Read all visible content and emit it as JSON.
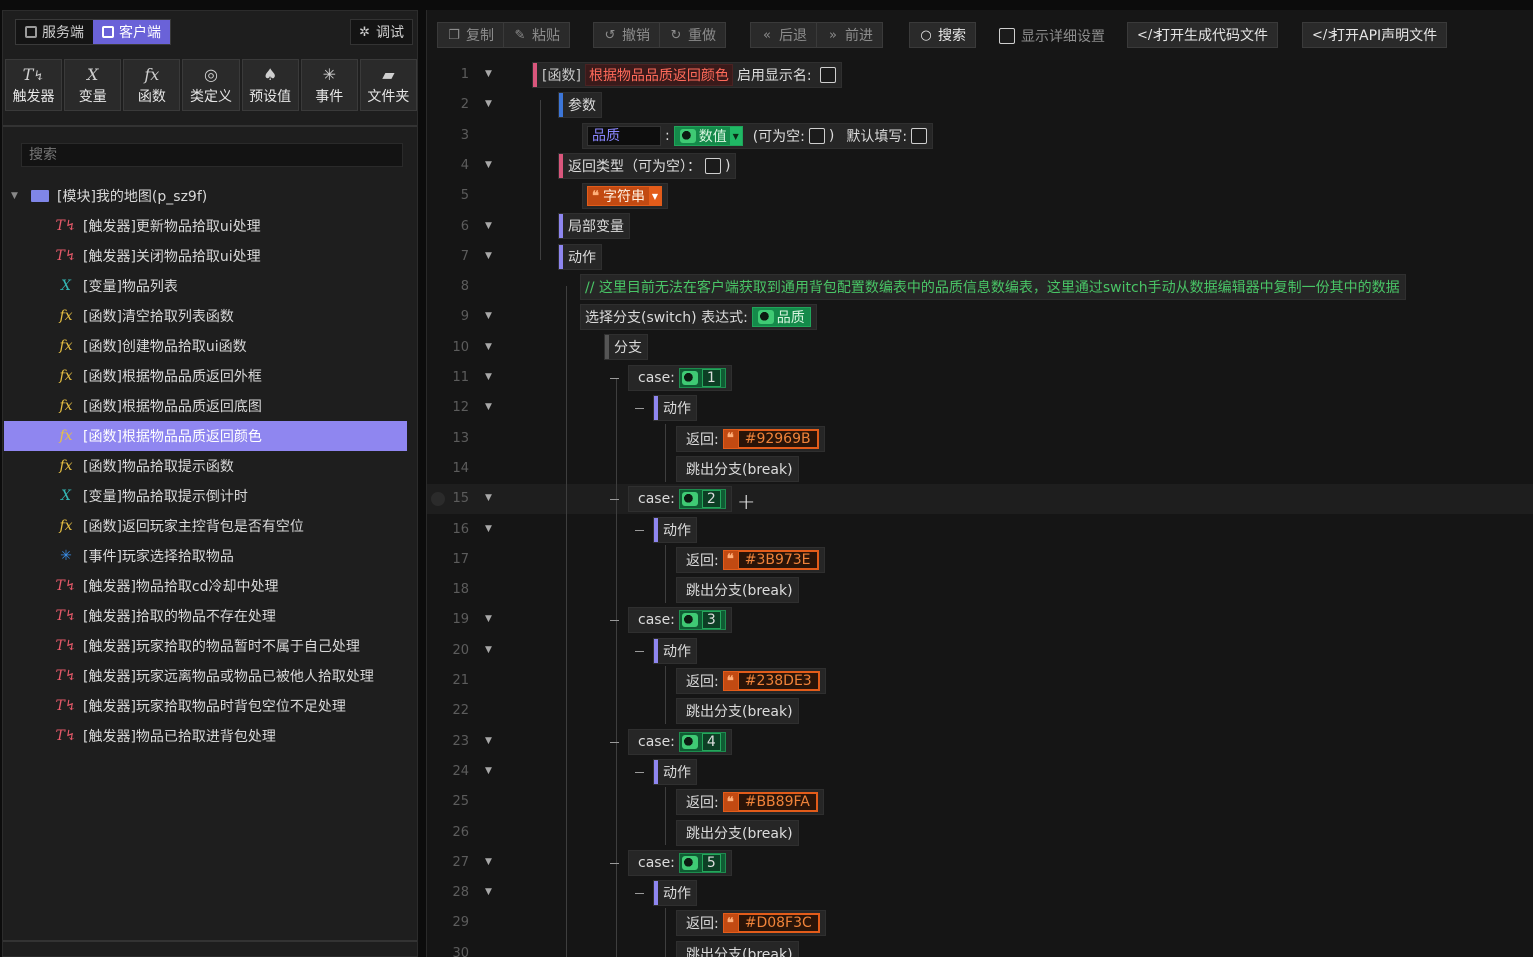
{
  "left_panel": {
    "tabs": [
      {
        "label": "服务端",
        "icon": "server-icon",
        "active": false
      },
      {
        "label": "客户端",
        "icon": "client-icon",
        "active": true
      }
    ],
    "debug_label": "调试",
    "tools": [
      {
        "label": "触发器",
        "icon": "trigger-icon"
      },
      {
        "label": "变量",
        "icon": "variable-icon"
      },
      {
        "label": "函数",
        "icon": "function-icon"
      },
      {
        "label": "类定义",
        "icon": "class-icon"
      },
      {
        "label": "预设值",
        "icon": "preset-icon"
      },
      {
        "label": "事件",
        "icon": "event-icon"
      },
      {
        "label": "文件夹",
        "icon": "folder-add-icon"
      }
    ],
    "search_placeholder": "搜索",
    "tree_root": "[模块]我的地图(p_sz9f)",
    "tree_items": [
      {
        "label": "[触发器]更新物品拾取ui处理",
        "kind": "trigger"
      },
      {
        "label": "[触发器]关闭物品拾取ui处理",
        "kind": "trigger"
      },
      {
        "label": "[变量]物品列表",
        "kind": "variable"
      },
      {
        "label": "[函数]清空拾取列表函数",
        "kind": "function"
      },
      {
        "label": "[函数]创建物品拾取ui函数",
        "kind": "function"
      },
      {
        "label": "[函数]根据物品品质返回外框",
        "kind": "function"
      },
      {
        "label": "[函数]根据物品品质返回底图",
        "kind": "function"
      },
      {
        "label": "[函数]根据物品品质返回颜色",
        "kind": "function",
        "selected": true
      },
      {
        "label": "[函数]物品拾取提示函数",
        "kind": "function"
      },
      {
        "label": "[变量]物品拾取提示倒计时",
        "kind": "variable"
      },
      {
        "label": "[函数]返回玩家主控背包是否有空位",
        "kind": "function"
      },
      {
        "label": "[事件]玩家选择拾取物品",
        "kind": "event"
      },
      {
        "label": "[触发器]物品拾取cd冷却中处理",
        "kind": "trigger"
      },
      {
        "label": "[触发器]拾取的物品不存在处理",
        "kind": "trigger"
      },
      {
        "label": "[触发器]玩家拾取的物品暂时不属于自己处理",
        "kind": "trigger"
      },
      {
        "label": "[触发器]玩家远离物品或物品已被他人拾取处理",
        "kind": "trigger"
      },
      {
        "label": "[触发器]玩家拾取物品时背包空位不足处理",
        "kind": "trigger"
      },
      {
        "label": "[触发器]物品已拾取进背包处理",
        "kind": "trigger"
      }
    ]
  },
  "toolbar": {
    "copy": "复制",
    "paste": "粘贴",
    "undo": "撤销",
    "redo": "重做",
    "back": "后退",
    "forward": "前进",
    "search": "搜索",
    "show_detail": "显示详细设置",
    "open_gen_code": "打开生成代码文件",
    "open_api_decl": "打开API声明文件"
  },
  "editor": {
    "func_tag": "[函数]",
    "func_name": "根据物品品质返回颜色",
    "enable_display_name": "启用显示名:",
    "params_label": "参数",
    "param_name": "品质",
    "param_colon": ":",
    "param_type": "数值",
    "nullable": "(可为空:",
    "nullable_close": ")",
    "default_fill": "默认填写:",
    "return_type": "返回类型（可为空）：",
    "return_type_close": ")",
    "return_type_value": "字符串",
    "local_vars": "局部变量",
    "actions": "动作",
    "comment": "// 这里目前无法在客户端获取到通用背包配置数编表中的品质信息数编表，这里通过switch手动从数据编辑器中复制一份其中的数据",
    "switch_label": "选择分支(switch) 表达式:",
    "switch_expr": "品质",
    "branch": "分支",
    "case_label": "case:",
    "return_label": "返回:",
    "break_label": "跳出分支(break)",
    "cases": [
      {
        "value": "1",
        "color": "#92969B"
      },
      {
        "value": "2",
        "color": "#3B973E"
      },
      {
        "value": "3",
        "color": "#238DE3"
      },
      {
        "value": "4",
        "color": "#BB89FA"
      },
      {
        "value": "5",
        "color": "#D08F3C"
      }
    ],
    "line_numbers": [
      "1",
      "2",
      "3",
      "4",
      "5",
      "6",
      "7",
      "8",
      "9",
      "10",
      "11",
      "12",
      "13",
      "14",
      "15",
      "16",
      "17",
      "18",
      "19",
      "20",
      "21",
      "22",
      "23",
      "24",
      "25",
      "26",
      "27",
      "28",
      "29",
      "30"
    ]
  }
}
